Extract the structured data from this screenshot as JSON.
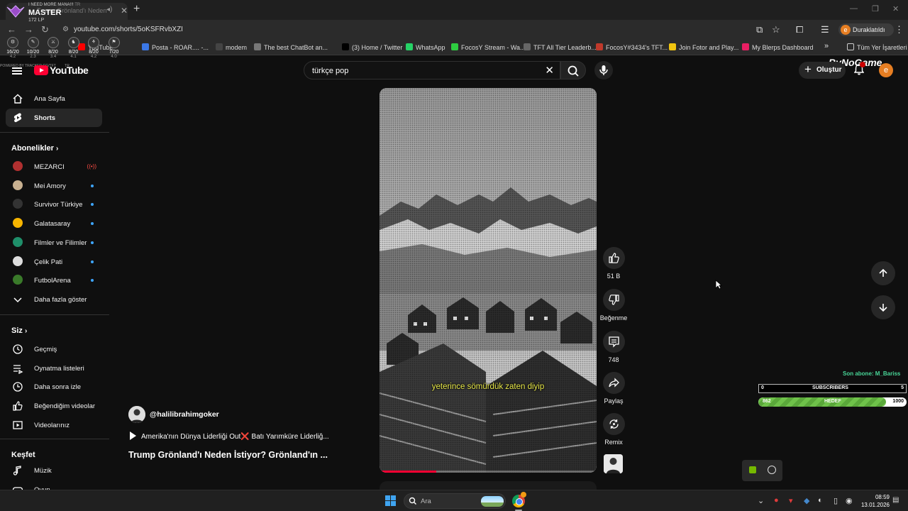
{
  "browser": {
    "tab_title": "Trump Grönland'ı Neden İstiyor",
    "url": "youtube.com/shorts/5oKSFRvbXZI",
    "profile_label": "Duraklatıldı",
    "profile_initial": "e",
    "bookmarks": [
      {
        "label": "YouTube",
        "color": "#ff0000"
      },
      {
        "label": "Posta - ROAR.... -...",
        "color": "#3b78e7"
      },
      {
        "label": "modem",
        "color": "#444444"
      },
      {
        "label": "The best ChatBot an...",
        "color": "#777777"
      },
      {
        "label": "(3) Home / Twitter",
        "color": "#000000"
      },
      {
        "label": "WhatsApp",
        "color": "#25d366"
      },
      {
        "label": "FocosY Stream - Wa...",
        "color": "#2ecc40"
      },
      {
        "label": "TFT All Tier Leaderb...",
        "color": "#666666"
      },
      {
        "label": "FocosY#3434's TFT...",
        "color": "#c0392b"
      },
      {
        "label": "Join Fotor and Play...",
        "color": "#f1c40f"
      },
      {
        "label": "My Blerps Dashboard",
        "color": "#e91e63"
      }
    ],
    "all_bookmarks_label": "Tüm Yer İşaretleri",
    "more_bookmarks": "»"
  },
  "tft_overlay": {
    "banner": "I NEED MORE MANA!!!",
    "region": "TR",
    "rank": "MASTER",
    "lp": "172 LP",
    "games": [
      {
        "score": "16/20",
        "avg": "4.2"
      },
      {
        "score": "10/20",
        "avg": "2.3"
      },
      {
        "score": "8/20",
        "avg": "3.4"
      },
      {
        "score": "8/20",
        "avg": "4.1"
      },
      {
        "score": "8/20",
        "avg": "4.2"
      },
      {
        "score": "7/20",
        "avg": "4.0"
      }
    ],
    "powered_by": "POWERED BY TRACKER.GG/TFT",
    "footer_region": "TR"
  },
  "youtube": {
    "logo_text": "YouTube",
    "search_query": "türkçe pop",
    "create_label": "Oluştur",
    "avatar_initial": "e",
    "sponsor_overlay": "ByNoGame",
    "sidebar": {
      "main": [
        {
          "label": "Ana Sayfa",
          "icon": "home-icon"
        },
        {
          "label": "Shorts",
          "icon": "shorts-icon",
          "active": true
        }
      ],
      "subscriptions_title": "Abonelikler",
      "subscriptions": [
        {
          "label": "MEZARCI",
          "color": "#b03030",
          "live": true
        },
        {
          "label": "Mei Amory",
          "color": "#c8b090"
        },
        {
          "label": "Survivor Türkiye",
          "color": "#333333"
        },
        {
          "label": "Galatasaray",
          "color": "#f7b500"
        },
        {
          "label": "Filmler ve Filimler",
          "color": "#1f8f6a"
        },
        {
          "label": "Çelik Pati",
          "color": "#dddddd"
        },
        {
          "label": "FutbolArena",
          "color": "#3a7a2a"
        }
      ],
      "show_more": "Daha fazla göster",
      "you_title": "Siz",
      "you_items": [
        {
          "label": "Geçmiş",
          "icon": "history-icon"
        },
        {
          "label": "Oynatma listeleri",
          "icon": "playlists-icon"
        },
        {
          "label": "Daha sonra izle",
          "icon": "watch-later-icon"
        },
        {
          "label": "Beğendiğim videolar",
          "icon": "liked-icon"
        },
        {
          "label": "Videolarınız",
          "icon": "your-videos-icon"
        }
      ],
      "explore_title": "Keşfet",
      "explore_items": [
        {
          "label": "Müzik",
          "icon": "music-icon"
        },
        {
          "label": "Oyun",
          "icon": "gaming-icon"
        }
      ]
    },
    "short": {
      "subtitle": "yeterince sömürdük zaten diyip",
      "progress": 0.26,
      "channel": "@halilibrahimgoker",
      "music": "Amerika'nın Dünya Liderliği Out",
      "music_rest": "Batı Yarımküre Liderliğ...",
      "title": "Trump Grönland'ı Neden İstiyor? Grönland'ın ...",
      "likes": "51 B",
      "dislike_label": "Beğenme",
      "comments": "748",
      "share_label": "Paylaş",
      "remix_label": "Remix"
    }
  },
  "stream_widget": {
    "last_sub_label": "Son abone: M_Bariss",
    "sub_min": "0",
    "sub_label": "SUBSCRIBERS",
    "sub_target": "5",
    "goal_current": "862",
    "goal_label": "HEDEF",
    "goal_target": "1000",
    "goal_fraction": 0.862
  },
  "taskbar": {
    "search_placeholder": "Ara",
    "time": "08:59",
    "date": "13.01.2026"
  },
  "colors": {
    "yt_red": "#ff0033",
    "bg": "#0f0f0f",
    "subtitle": "#e8e84a",
    "goal_green": "#6fc24a"
  }
}
